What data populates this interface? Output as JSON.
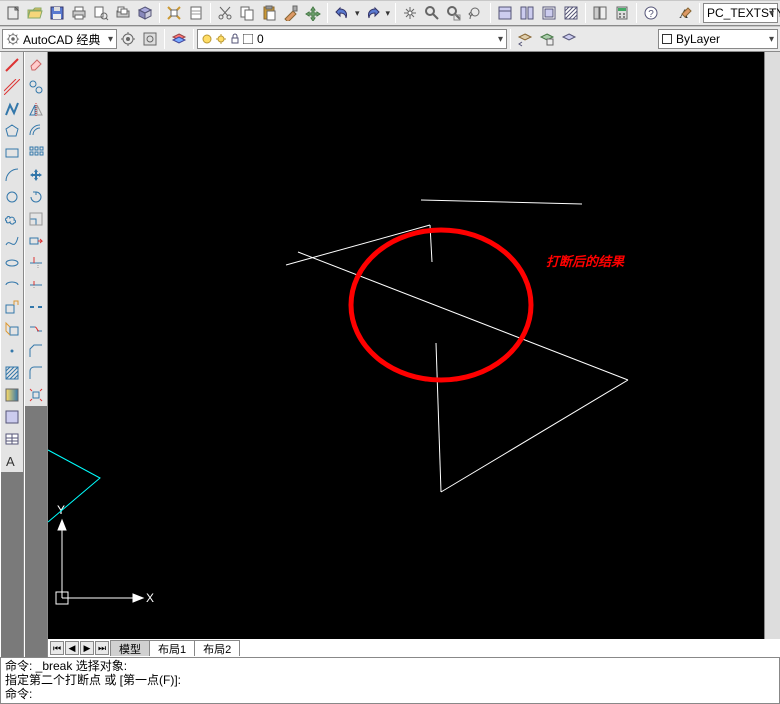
{
  "toolbar1": {
    "icons": [
      "new",
      "open",
      "save",
      "plot",
      "plot-preview",
      "publish",
      "3d-print",
      "properties",
      "sheet",
      "cut",
      "copy",
      "paste",
      "match",
      "pan-roam",
      "undo",
      "redo",
      "separator",
      "pan",
      "zoom-realtime",
      "zoom-window",
      "zoom-prev",
      "tile-v",
      "tile-h",
      "layouts",
      "hatch-manager",
      "tool-palettes",
      "calc",
      "help"
    ]
  },
  "textstyle_group": {
    "label": "PC_TEXTSTY",
    "icon": "text-style"
  },
  "toolbar2": {
    "workspace_label": "AutoCAD 经典",
    "gear_icon": "workspace-settings",
    "cog_icon": "workspace-gear",
    "layer_icons": [
      "layer-props",
      "layer-on",
      "layer-freeze",
      "layer-lock",
      "layer-color"
    ],
    "layer_label": "0",
    "layer_right_icons": [
      "layer-prev",
      "layer-state",
      "layer-iso"
    ],
    "bylayer_label": "ByLayer"
  },
  "left_col_a": [
    "line",
    "construction-line",
    "polyline",
    "polygon",
    "rectangle",
    "arc",
    "circle",
    "revision-cloud",
    "spline",
    "ellipse",
    "ellipse-arc",
    "insert-block",
    "make-block",
    "point",
    "hatch",
    "gradient",
    "region",
    "table",
    "multiline-text"
  ],
  "left_col_b": [
    "distance",
    "quick-select",
    "draw-order",
    "spell",
    "select-similar",
    "break-at-point",
    "move",
    "rotate",
    "trim",
    "extend",
    "fillet",
    "array",
    "measure",
    "area",
    "scale",
    "stretch",
    "explode",
    "offset",
    "edit-polyline"
  ],
  "axes": {
    "x": "X",
    "y": "Y"
  },
  "annotation": "打断后的结果",
  "tabs": {
    "model": "模型",
    "layout1": "布局1",
    "layout2": "布局2"
  },
  "cmd": {
    "line1": "命令:  _break 选择对象:",
    "line2": "指定第二个打断点 或 [第一点(F)]:",
    "line3": "命令:"
  }
}
